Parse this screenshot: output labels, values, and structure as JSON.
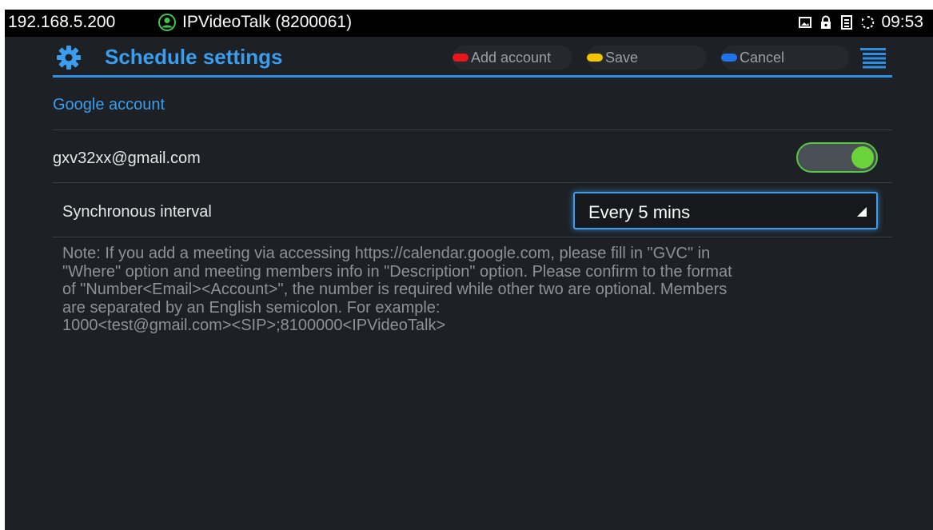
{
  "status_bar": {
    "ip": "192.168.5.200",
    "account": "IPVideoTalk (8200061)",
    "time": "09:53",
    "icons": [
      "image-icon",
      "lock-icon",
      "sim-icon",
      "sync-icon"
    ]
  },
  "header": {
    "title": "Schedule settings",
    "buttons": {
      "add_account": "Add account",
      "save": "Save",
      "cancel": "Cancel"
    },
    "colors": {
      "accent": "#3a9ded",
      "red": "#e8161f",
      "yellow": "#f5c400",
      "blue": "#1e74e8"
    }
  },
  "google_section": {
    "title": "Google account",
    "account_email": "gxv32xx@gmail.com",
    "account_enabled": true,
    "interval_label": "Synchronous interval",
    "interval_value": "Every 5 mins"
  },
  "note": {
    "lines": [
      "Note: If you add a meeting via accessing https://calendar.google.com, please fill in \"GVC\" in",
      "\"Where\" option and meeting members info in \"Description\" option. Please confirm to the format",
      "of \"Number<Email><Account>\", the number is required while other two are optional. Members",
      "are separated by an English semicolon. For example:",
      "1000<test@gmail.com><SIP>;8100000<IPVideoTalk>"
    ]
  }
}
